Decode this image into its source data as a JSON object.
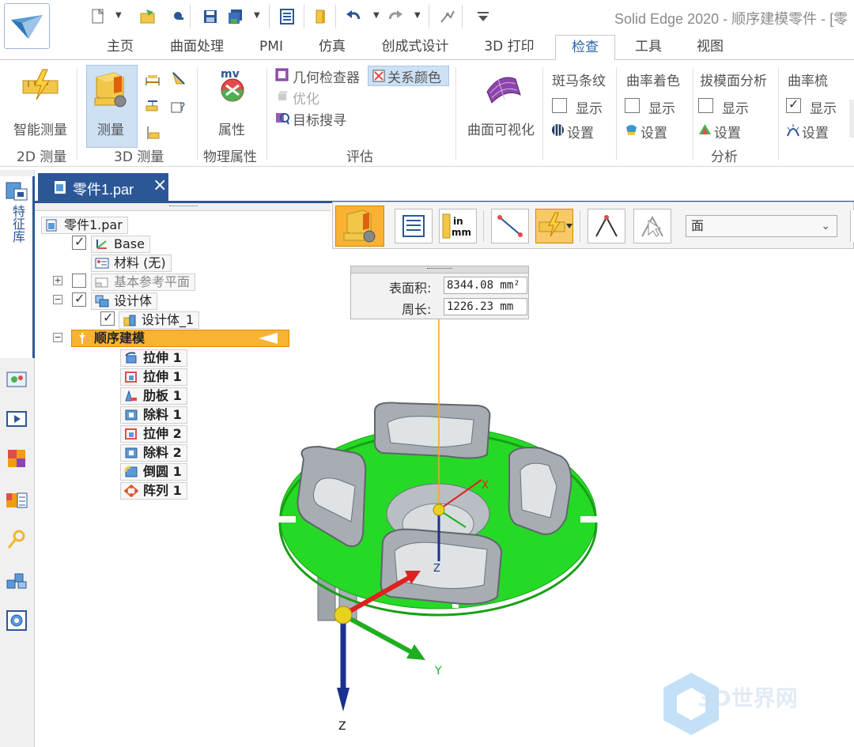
{
  "window": {
    "title": "Solid Edge 2020 - 顺序建模零件 - [零"
  },
  "ribbon_tabs": [
    {
      "label": "主页"
    },
    {
      "label": "曲面处理"
    },
    {
      "label": "PMI"
    },
    {
      "label": "仿真"
    },
    {
      "label": "创成式设计"
    },
    {
      "label": "3D 打印"
    },
    {
      "label": "检查",
      "active": true
    },
    {
      "label": "工具"
    },
    {
      "label": "视图"
    }
  ],
  "ribbon": {
    "smart_measure": "智能测量",
    "measure": "测量",
    "attributes": "属性",
    "geometry_inspector": "几何检查器",
    "relation_colors": "关系颜色",
    "optimize": "优化",
    "target_search": "目标搜寻",
    "surface_visualize": "曲面可视化",
    "zebra": "斑马条纹",
    "curvature_shading": "曲率着色",
    "draft_analysis": "拔模面分析",
    "curvature_comb": "曲率梳",
    "show": "显示",
    "settings": "设置",
    "groups": {
      "measure2d": "2D 测量",
      "measure3d": "3D 测量",
      "physical": "物理属性",
      "evaluate": "评估",
      "analysis": "分析"
    },
    "checkbox_states": {
      "zebra_show": false,
      "curvature_shading_show": false,
      "draft_show": false,
      "curvature_comb_show": true
    }
  },
  "left_panel": {
    "vertical_label": "特征库"
  },
  "document_tab": {
    "label": "零件1.par",
    "close": "×"
  },
  "tree": {
    "root": "零件1.par",
    "base": "Base",
    "material": "材料 (无)",
    "ref_planes": "基本参考平面",
    "design_body": "设计体",
    "design_body_1": "设计体_1",
    "sequential": "顺序建模",
    "features": [
      "拉伸 1",
      "拉伸 1",
      "肋板 1",
      "除料 1",
      "拉伸 2",
      "除料 2",
      "倒圆 1",
      "阵列 1"
    ],
    "checks": {
      "base": true,
      "ref_planes": false,
      "design_body": true,
      "design_body_1": true
    }
  },
  "measure_toolbar": {
    "units_label": "in\nmm",
    "select_value": "面"
  },
  "measure_panel": {
    "area_label": "表面积:",
    "area_value": "8344.08 mm²",
    "perimeter_label": "周长:",
    "perimeter_value": "1226.23 mm"
  },
  "axes": {
    "x": "X",
    "y": "Y",
    "z": "Z"
  },
  "watermark": "3D世界网",
  "colors": {
    "accent": "#2b5797",
    "selection": "#f5a623",
    "face_green": "#22dd22",
    "model_gray": "#9ea4aa"
  }
}
